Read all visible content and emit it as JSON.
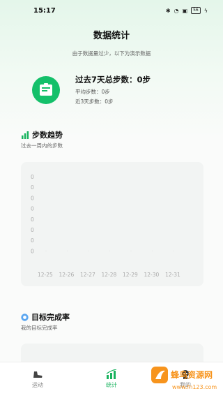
{
  "status_bar": {
    "time": "15:17",
    "battery": "56"
  },
  "header": {
    "title": "数据统计"
  },
  "notice": "由于数据量过少，以下为演示数据",
  "summary": {
    "icon": "clipboard-icon",
    "total_label": "过去7天总步数：0步",
    "average_label": "平均步数：0步",
    "recent_label": "近3天步数：0步"
  },
  "trend": {
    "title": "步数趋势",
    "subtitle": "过去一周内的步数",
    "icon": "bar-chart-icon"
  },
  "chart_data": {
    "type": "line",
    "categories": [
      "12-25",
      "12-26",
      "12-27",
      "12-28",
      "12-29",
      "12-30",
      "12-31"
    ],
    "y_tick_labels": [
      "0",
      "0",
      "0",
      "0",
      "0",
      "0",
      "0",
      "0"
    ],
    "series": [
      {
        "values": [
          0,
          0,
          0,
          0,
          0,
          0,
          0
        ]
      }
    ],
    "title": "",
    "xlabel": "",
    "ylabel": "",
    "grid": false
  },
  "goal": {
    "title": "目标完成率",
    "subtitle": "我的目标完成率",
    "icon": "target-icon"
  },
  "tabs": [
    {
      "label": "运动",
      "icon": "shoe-icon",
      "active": false
    },
    {
      "label": "统计",
      "icon": "stats-icon",
      "active": true
    },
    {
      "label": "我的",
      "icon": "user-icon",
      "active": false
    }
  ],
  "watermark": {
    "text": "蜂鸟资源网",
    "url": "www.fn123.com"
  },
  "colors": {
    "accent": "#18b35e",
    "icon_green": "#14c06a",
    "tick_gray": "#aaaaaa"
  }
}
